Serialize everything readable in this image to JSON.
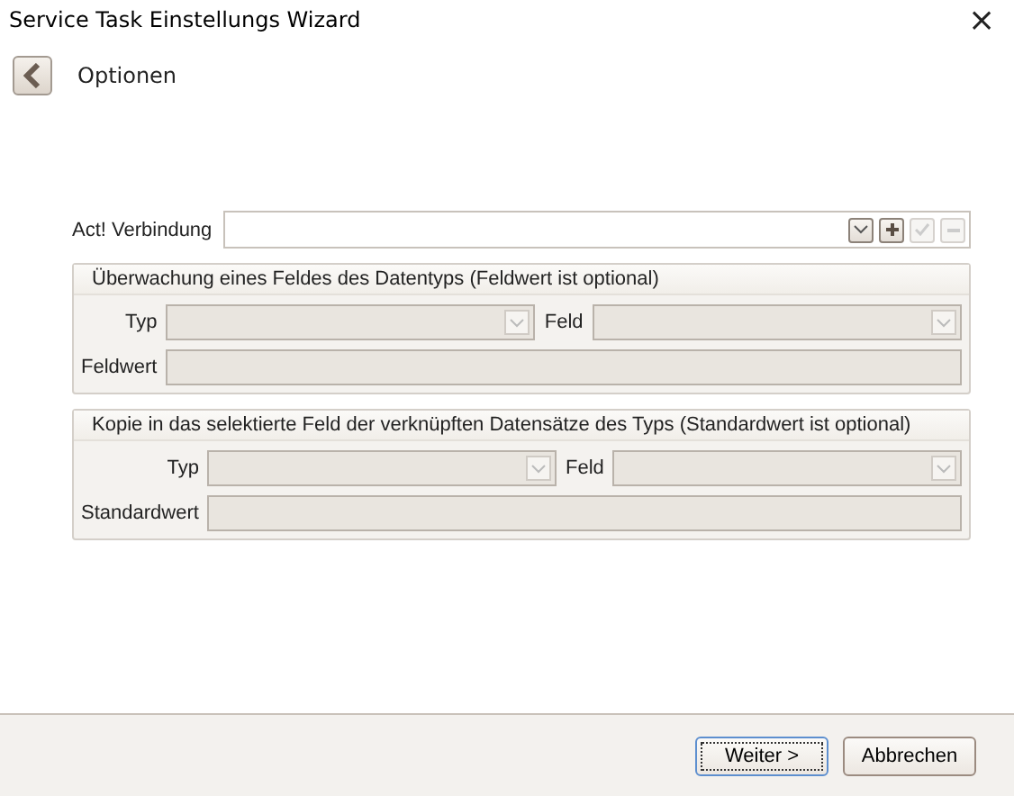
{
  "window": {
    "title": "Service Task Einstellungs Wizard",
    "close": "×"
  },
  "page": {
    "title": "Optionen"
  },
  "connection": {
    "label": "Act! Verbindung",
    "buttons": [
      {
        "kind": "dropdown",
        "disabled": false
      },
      {
        "kind": "add",
        "disabled": false
      },
      {
        "kind": "confirm",
        "disabled": true
      },
      {
        "kind": "remove",
        "disabled": true
      }
    ]
  },
  "groups": [
    {
      "title": "Überwachung eines Feldes des Datentyps (Feldwert ist optional)",
      "type_label": "Typ",
      "field_label": "Feld",
      "value_label": "Feldwert",
      "disabled": true
    },
    {
      "title": "Kopie in das selektierte Feld der verknüpften Datensätze des Typs (Standardwert ist optional)",
      "type_label": "Typ",
      "field_label": "Feld",
      "value_label": "Standardwert",
      "disabled": true
    }
  ],
  "buttons": [
    {
      "label": "Weiter >",
      "focused": true
    },
    {
      "label": "Abbrechen",
      "focused": false
    }
  ]
}
